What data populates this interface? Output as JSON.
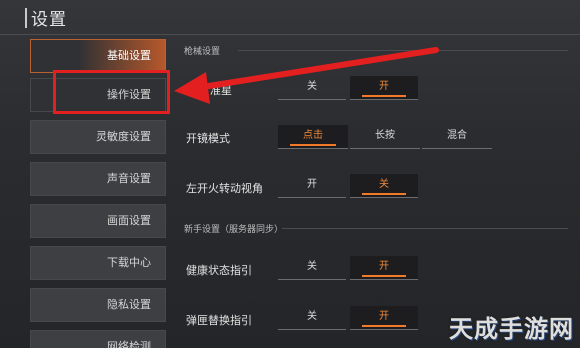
{
  "header": {
    "title": "设置"
  },
  "sidebar": {
    "items": [
      {
        "label": "基础设置",
        "state": "active"
      },
      {
        "label": "操作设置",
        "state": "highlight"
      },
      {
        "label": "灵敏度设置",
        "state": "normal"
      },
      {
        "label": "声音设置",
        "state": "normal"
      },
      {
        "label": "画面设置",
        "state": "normal"
      },
      {
        "label": "下载中心",
        "state": "normal"
      },
      {
        "label": "隐私设置",
        "state": "normal"
      },
      {
        "label": "网络检测",
        "state": "normal"
      }
    ]
  },
  "sections": {
    "gun": {
      "title": "枪械设置"
    },
    "newbie": {
      "title": "新手设置（服务器同步）"
    }
  },
  "rows": {
    "crosshair": {
      "label": "准星",
      "options": [
        "关",
        "开"
      ],
      "selected": "开"
    },
    "scope": {
      "label": "开镜模式",
      "options": [
        "点击",
        "长按",
        "混合"
      ],
      "selected": "点击"
    },
    "fire_view": {
      "label": "左开火转动视角",
      "options": [
        "开",
        "关"
      ],
      "selected": "关"
    },
    "health_guide": {
      "label": "健康状态指引",
      "options": [
        "关",
        "开"
      ],
      "selected": "开"
    },
    "clip_guide": {
      "label": "弹匣替换指引",
      "options": [
        "关",
        "开"
      ],
      "selected": "开"
    }
  },
  "colors": {
    "accent": "#f07a2a",
    "annotation_red": "#e41f1f"
  },
  "watermark": {
    "text": "天成手游网"
  }
}
